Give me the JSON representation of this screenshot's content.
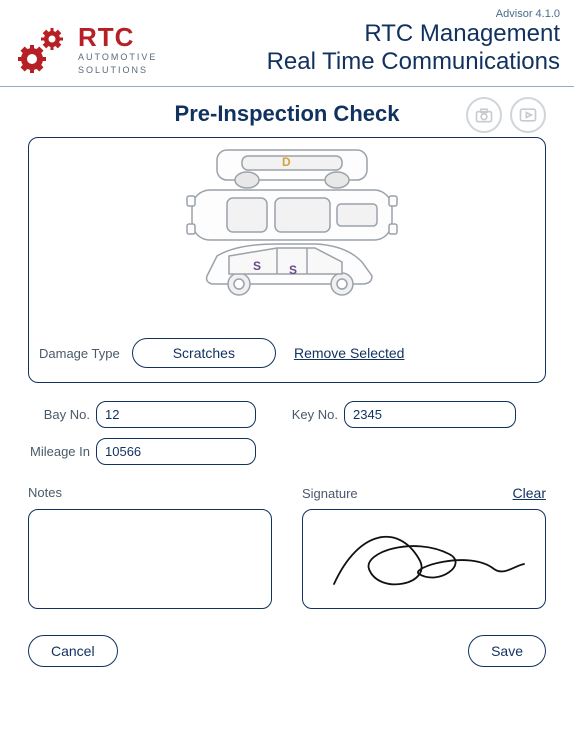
{
  "header": {
    "version": "Advisor 4.1.0",
    "logo": {
      "brand": "RTC",
      "subtitle_line1": "AUTOMOTIVE",
      "subtitle_line2": "SOLUTIONS"
    },
    "title_line1": "RTC Management",
    "title_line2": "Real Time Communications"
  },
  "page": {
    "title": "Pre-Inspection Check",
    "camera_icon": "camera-icon",
    "play_icon": "play-icon"
  },
  "damage": {
    "label": "Damage Type",
    "selected": "Scratches",
    "remove_label": "Remove Selected",
    "markers": [
      {
        "code": "D",
        "color": "#d9a23a"
      },
      {
        "code": "S",
        "color": "#6a4a8a"
      },
      {
        "code": "S",
        "color": "#6a4a8a"
      }
    ]
  },
  "fields": {
    "bay": {
      "label": "Bay No.",
      "value": "12"
    },
    "key": {
      "label": "Key No.",
      "value": "2345"
    },
    "mileage": {
      "label": "Mileage In",
      "value": "10566"
    }
  },
  "notes": {
    "label": "Notes",
    "value": ""
  },
  "signature": {
    "label": "Signature",
    "clear_label": "Clear"
  },
  "footer": {
    "cancel": "Cancel",
    "save": "Save"
  }
}
